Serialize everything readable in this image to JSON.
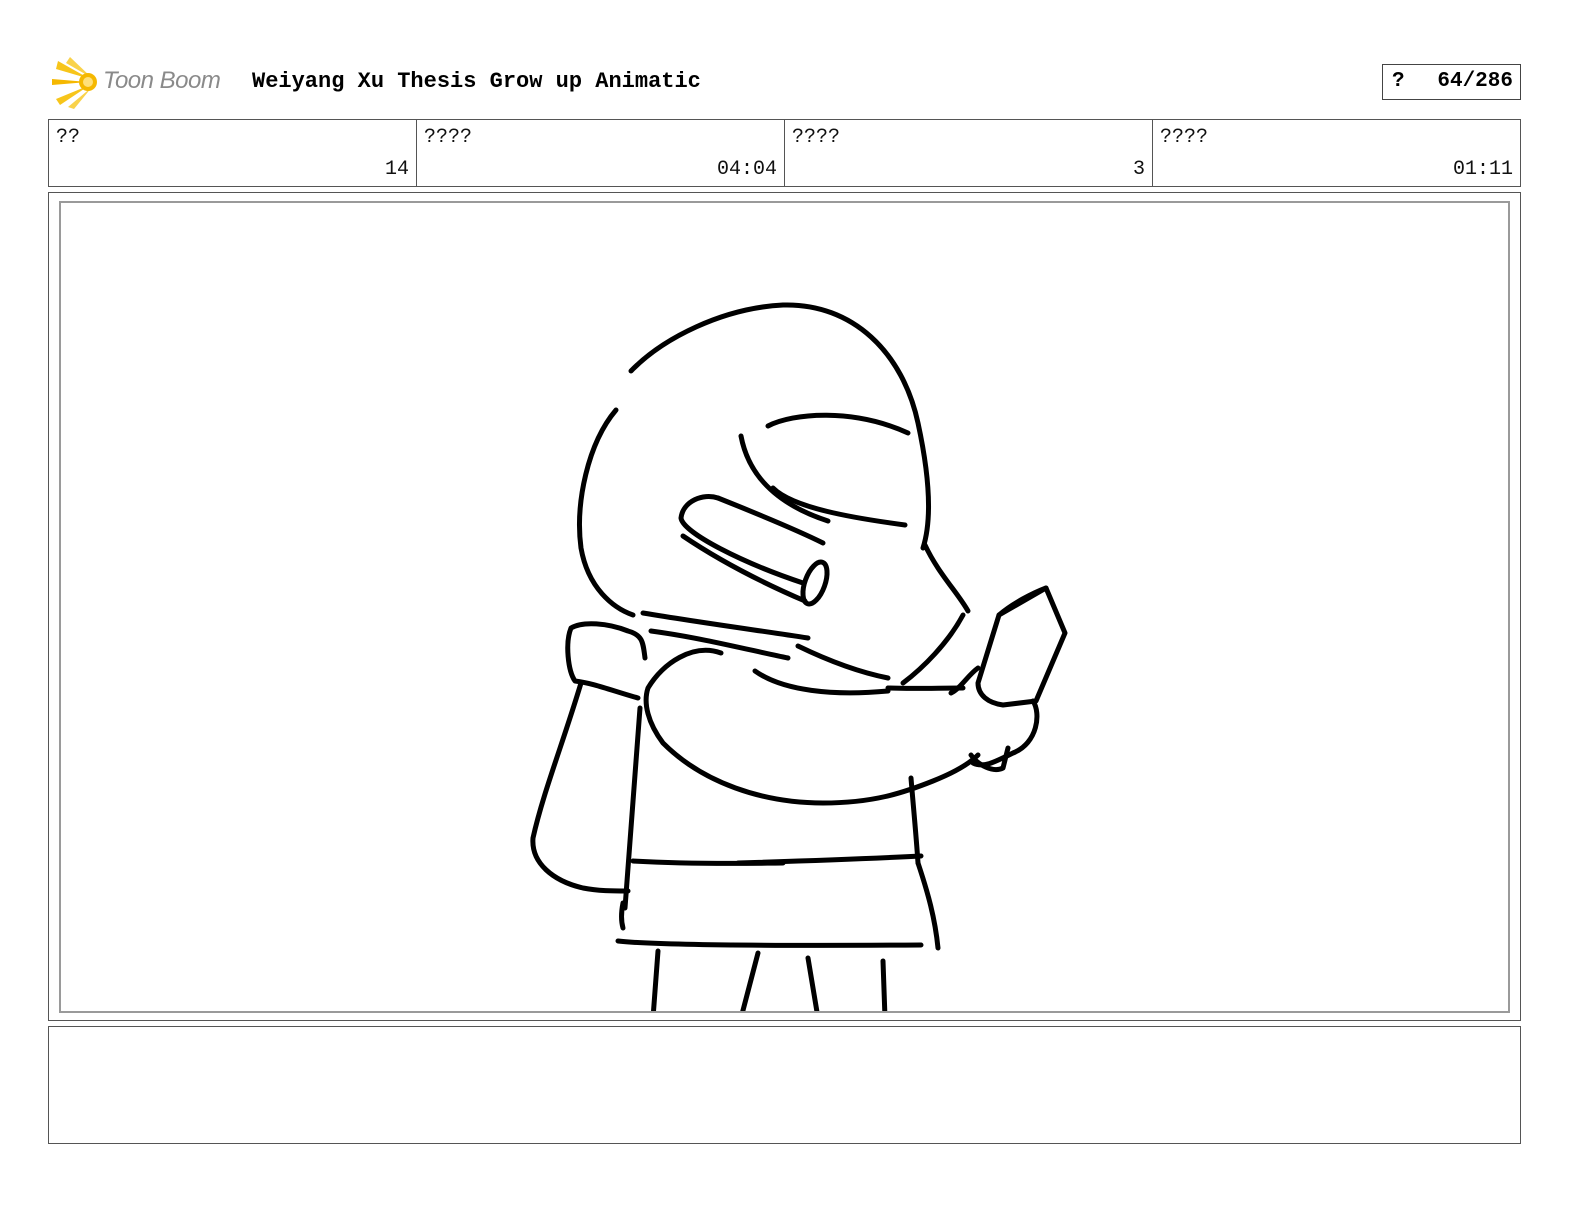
{
  "header": {
    "logo_text": "Toon Boom",
    "project_title": "Weiyang Xu Thesis Grow up Animatic",
    "page_label": "?",
    "page_counter": "64/286"
  },
  "info_fields": [
    {
      "label": "??",
      "value": "14"
    },
    {
      "label": "????",
      "value": "04:04"
    },
    {
      "label": "????",
      "value": "3"
    },
    {
      "label": "????",
      "value": "01:11"
    }
  ],
  "notes": {
    "text": ""
  },
  "colors": {
    "logo_yellow": "#f5b800",
    "logo_text": "#8a8a8a",
    "ink": "#000000"
  }
}
